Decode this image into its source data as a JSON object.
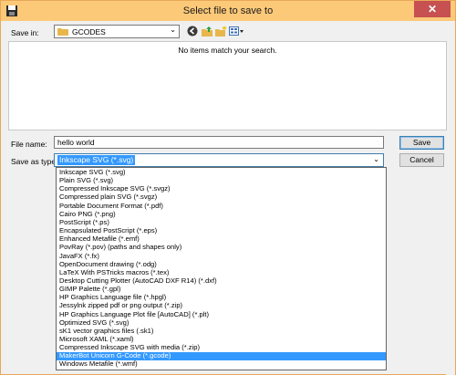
{
  "window": {
    "title": "Select file to save to",
    "close_label": "✕"
  },
  "save_in": {
    "label": "Save in:",
    "value": "GCODES",
    "arrow": "⌄"
  },
  "toolbar": {
    "back_icon": "back-icon",
    "up_icon": "up-folder-icon",
    "new_folder_icon": "new-folder-icon",
    "view_menu_icon": "view-menu-icon"
  },
  "file_list": {
    "empty_message": "No items match your search."
  },
  "file_name": {
    "label": "File name:",
    "value": "hello world"
  },
  "save_as_type": {
    "label": "Save as type:",
    "value": "Inkscape SVG (*.svg)",
    "arrow": "⌄",
    "options": [
      "Inkscape SVG (*.svg)",
      "Plain SVG (*.svg)",
      "Compressed Inkscape SVG (*.svgz)",
      "Compressed plain SVG (*.svgz)",
      "Portable Document Format (*.pdf)",
      "Cairo PNG (*.png)",
      "PostScript (*.ps)",
      "Encapsulated PostScript (*.eps)",
      "Enhanced Metafile (*.emf)",
      "PovRay (*.pov) (paths and shapes only)",
      "JavaFX (*.fx)",
      "OpenDocument drawing (*.odg)",
      "LaTeX With PSTricks macros (*.tex)",
      "Desktop Cutting Plotter (AutoCAD DXF R14) (*.dxf)",
      "GIMP Palette (*.gpl)",
      "HP Graphics Language file (*.hpgl)",
      "Jessylnk zipped pdf or png output (*.zip)",
      "HP Graphics Language Plot file [AutoCAD] (*.plt)",
      "Optimized SVG (*.svg)",
      "sK1 vector graphics files (.sk1)",
      "Microsoft XAML (*.xaml)",
      "Compressed Inkscape SVG with media (*.zip)",
      "MakerBot Unicorn G-Code (*.gcode)",
      "Windows Metafile (*.wmf)"
    ],
    "highlighted_index": 22
  },
  "buttons": {
    "save": "Save",
    "cancel": "Cancel"
  },
  "colors": {
    "titlebar": "#fcc979",
    "selection": "#3399ff",
    "close": "#c75050"
  }
}
